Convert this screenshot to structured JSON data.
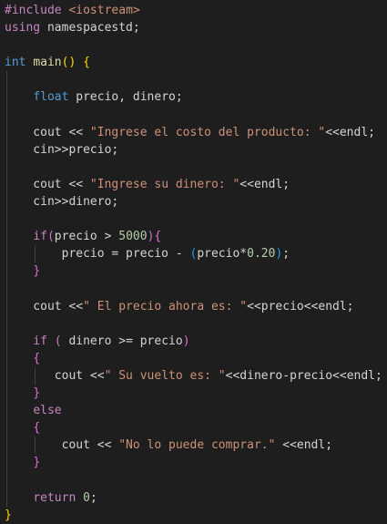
{
  "code_lines": [
    "#include <iostream>",
    "using namespacestd;",
    "",
    "int main() {",
    "",
    "    float precio, dinero;",
    "",
    "    cout << \"Ingrese el costo del producto: \"<<endl;",
    "    cin>>precio;",
    "",
    "    cout << \"Ingrese su dinero: \"<<endl;",
    "    cin>>dinero;",
    "",
    "    if(precio > 5000){",
    "        precio = precio - (precio*0.20);",
    "    }",
    "",
    "    cout <<\" El precio ahora es: \"<<precio<<endl;",
    "",
    "    if ( dinero >= precio)",
    "    {",
    "       cout <<\" Su vuelto es: \"<<dinero-precio<<endl;",
    "    }",
    "    else",
    "    {",
    "        cout << \"No lo puede comprar.\" <<endl;",
    "    }",
    "",
    "    return 0;",
    "}"
  ],
  "colors": {
    "background": "#1e1e1e",
    "keyword": "#569cd6",
    "control": "#c586c0",
    "string": "#ce9178",
    "number": "#b5cea8",
    "text": "#d4d4d4",
    "bracket_gold": "#ffd700",
    "bracket_purple": "#da70d6"
  }
}
